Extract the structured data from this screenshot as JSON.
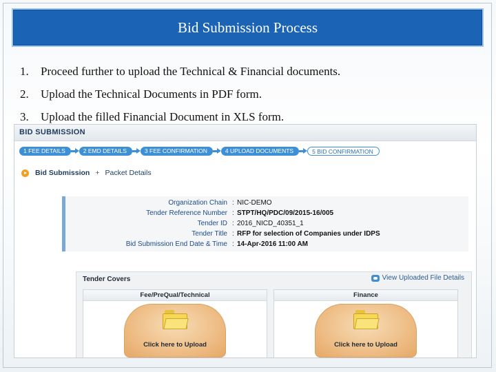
{
  "slide": {
    "title": "Bid Submission Process",
    "steps": [
      {
        "num": "1.",
        "text": "Proceed further to upload the Technical & Financial documents."
      },
      {
        "num": "2.",
        "text": "Upload the Technical Documents in PDF form."
      },
      {
        "num": "3.",
        "text": "Upload the filled Financial Document in XLS form."
      }
    ]
  },
  "screenshot": {
    "header": "BID SUBMISSION",
    "wizard": [
      "1  FEE DETAILS",
      "2  EMD DETAILS",
      "3  FEE CONFIRMATION",
      "4  UPLOAD DOCUMENTS",
      "5  BID CONFIRMATION"
    ],
    "breadcrumb": {
      "current": "Bid Submission",
      "separator": "+",
      "next": "Packet Details"
    },
    "details": [
      {
        "label": "Organization Chain",
        "value": "NIC-DEMO"
      },
      {
        "label": "Tender Reference Number",
        "value": "STPT/HQ/PDC/09/2015-16/005"
      },
      {
        "label": "Tender ID",
        "value": "2016_NICD_40351_1"
      },
      {
        "label": "Tender Title",
        "value": "RFP for selection of Companies under IDPS"
      },
      {
        "label": "Bid Submission End Date & Time",
        "value": "14-Apr-2016 11:00 AM"
      }
    ],
    "covers": {
      "title": "Tender Covers",
      "view_link": "View Uploaded File Details",
      "items": [
        {
          "title": "Fee/PreQual/Technical",
          "button": "Click here to Upload"
        },
        {
          "title": "Finance",
          "button": "Click here to Upload"
        }
      ]
    }
  },
  "colors": {
    "title_bar": "#1a63b5",
    "wizard_step": "#3d8fd6",
    "upload_button": "#efc08a",
    "label_text": "#1f4a86"
  }
}
